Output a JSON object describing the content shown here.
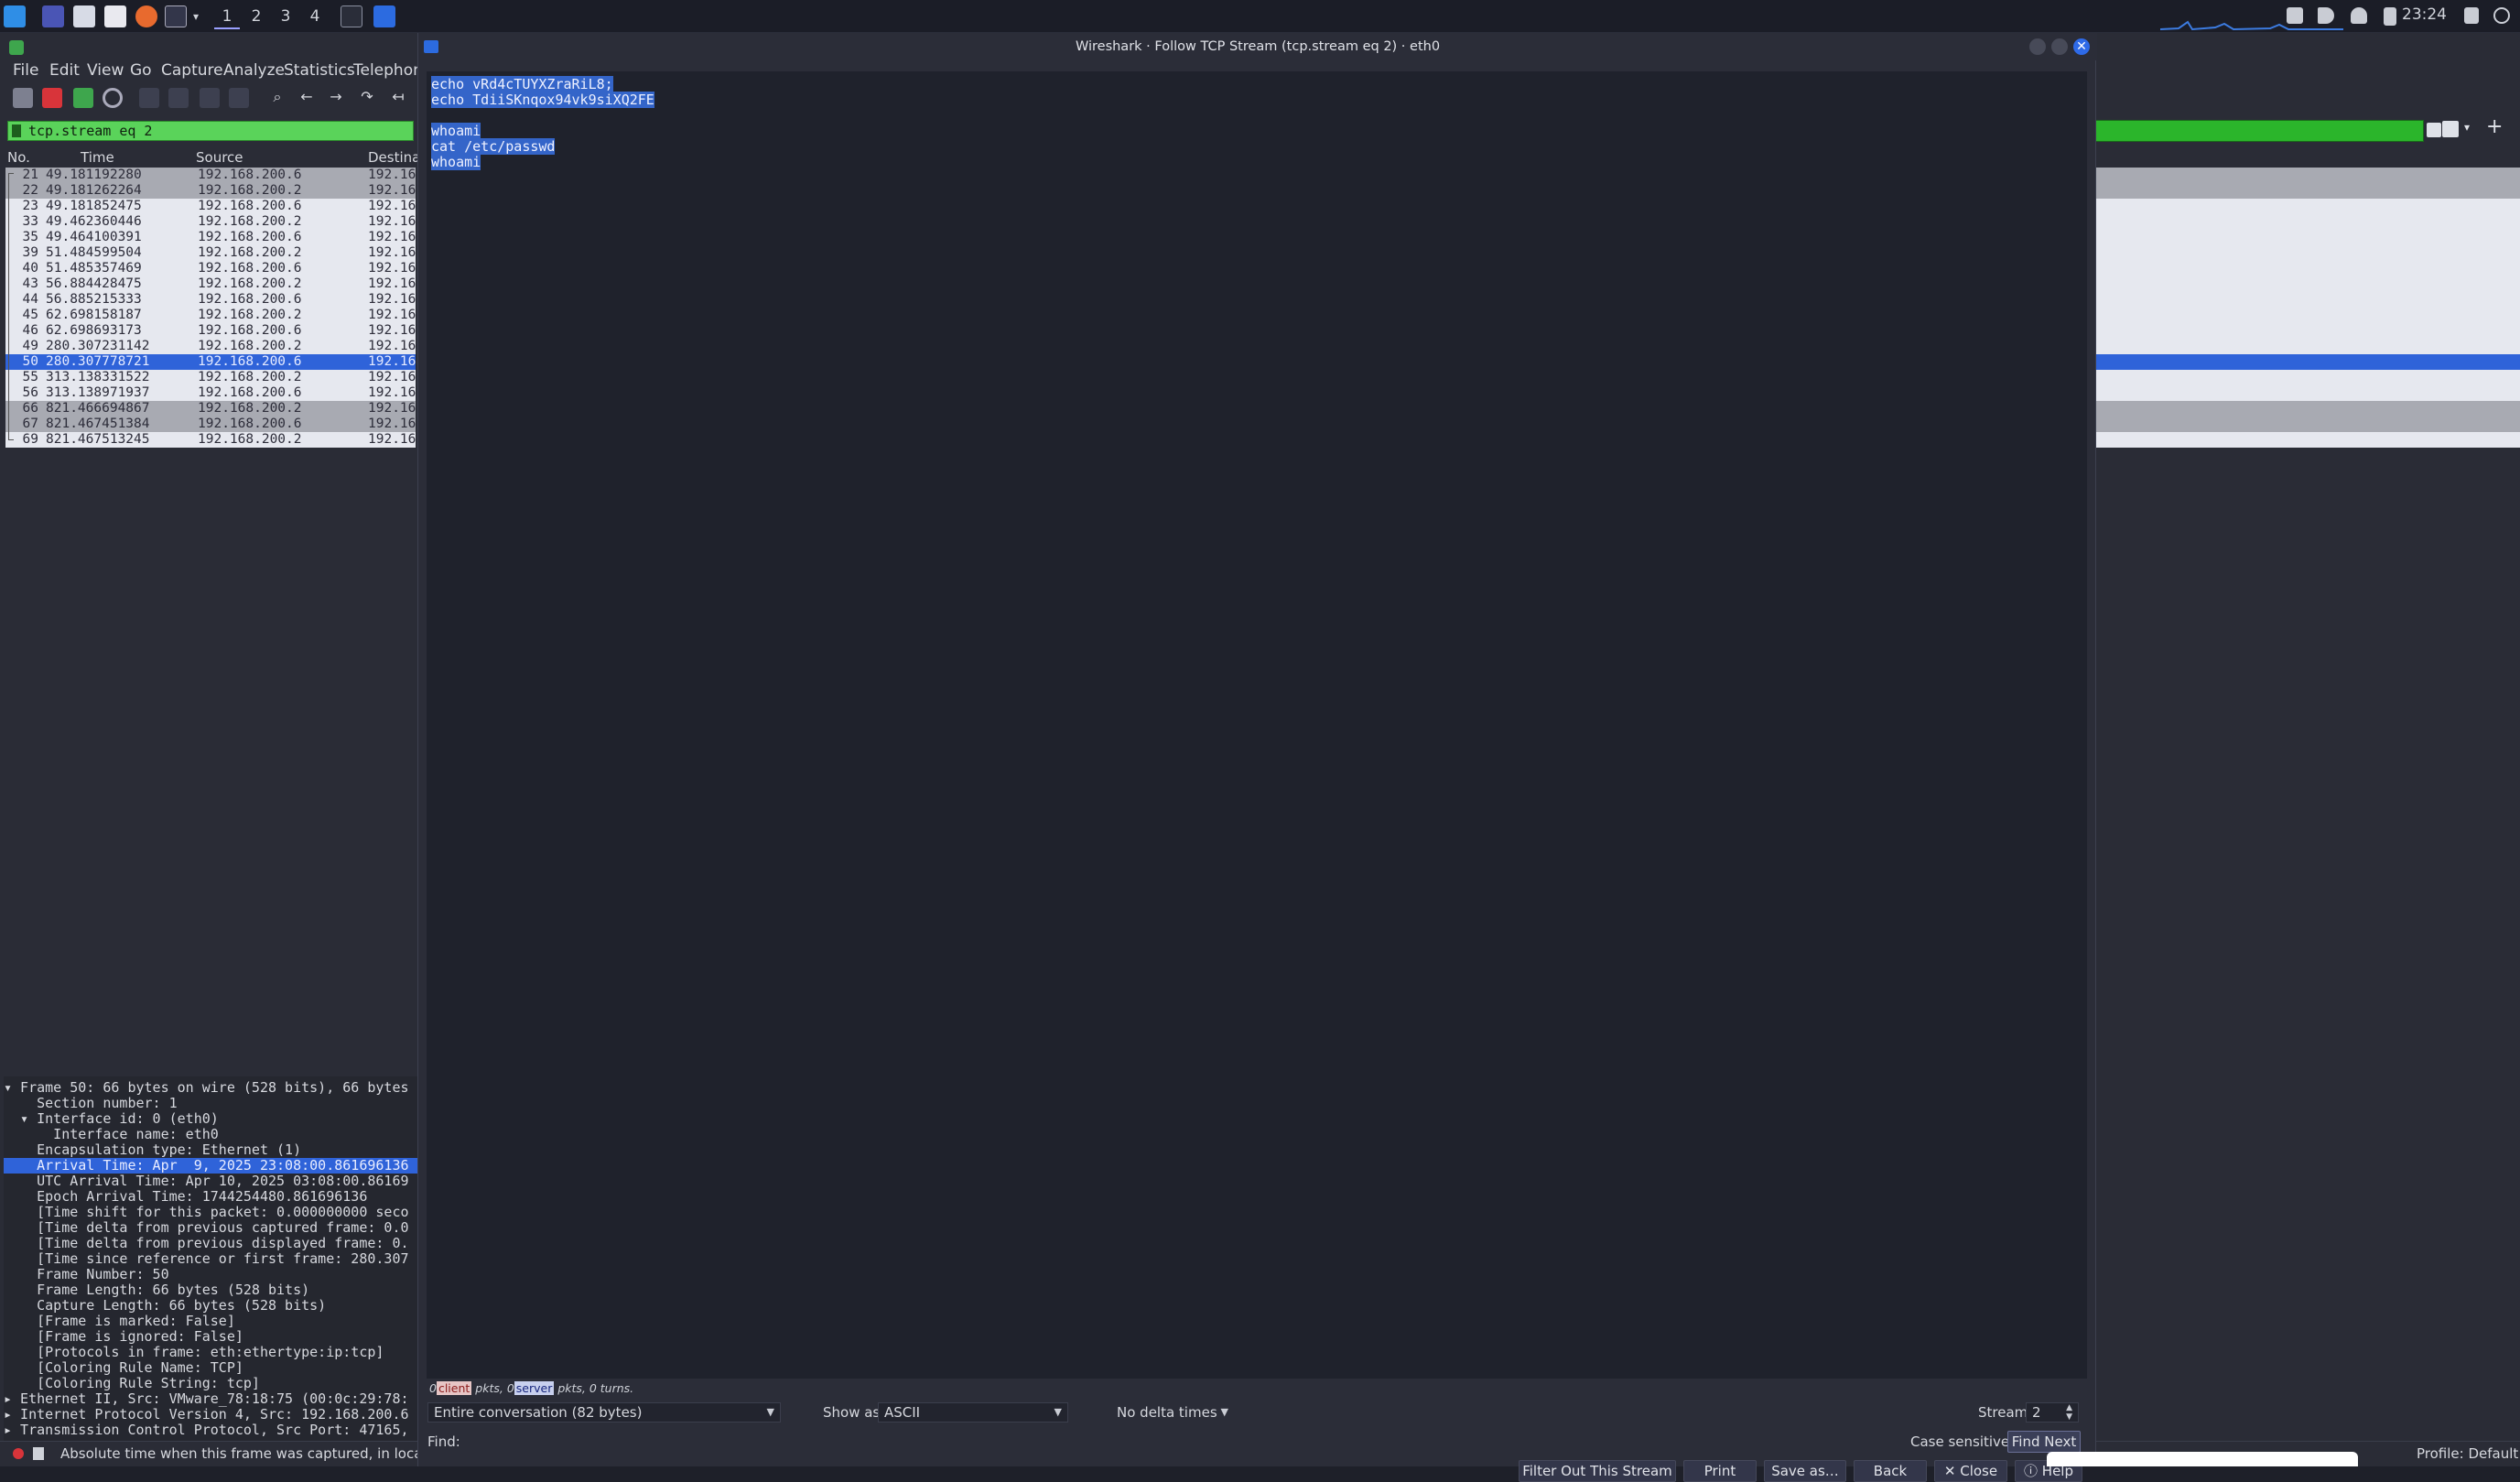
{
  "taskbar": {
    "workspaces": [
      "1",
      "2",
      "3",
      "4"
    ],
    "clock": "23:24"
  },
  "main": {
    "menu": [
      "File",
      "Edit",
      "View",
      "Go",
      "Capture",
      "Analyze",
      "Statistics",
      "Telephony"
    ],
    "filter": "tcp.stream eq 2",
    "columns": [
      "No.",
      "Time",
      "Source",
      "Destina"
    ],
    "packets": [
      {
        "no": "21",
        "time": "49.181192280",
        "src": "192.168.200.6",
        "dst": "192.16"
      },
      {
        "no": "22",
        "time": "49.181262264",
        "src": "192.168.200.2",
        "dst": "192.16"
      },
      {
        "no": "23",
        "time": "49.181852475",
        "src": "192.168.200.6",
        "dst": "192.16"
      },
      {
        "no": "33",
        "time": "49.462360446",
        "src": "192.168.200.2",
        "dst": "192.16"
      },
      {
        "no": "35",
        "time": "49.464100391",
        "src": "192.168.200.6",
        "dst": "192.16"
      },
      {
        "no": "39",
        "time": "51.484599504",
        "src": "192.168.200.2",
        "dst": "192.16"
      },
      {
        "no": "40",
        "time": "51.485357469",
        "src": "192.168.200.6",
        "dst": "192.16"
      },
      {
        "no": "43",
        "time": "56.884428475",
        "src": "192.168.200.2",
        "dst": "192.16"
      },
      {
        "no": "44",
        "time": "56.885215333",
        "src": "192.168.200.6",
        "dst": "192.16"
      },
      {
        "no": "45",
        "time": "62.698158187",
        "src": "192.168.200.2",
        "dst": "192.16"
      },
      {
        "no": "46",
        "time": "62.698693173",
        "src": "192.168.200.6",
        "dst": "192.16"
      },
      {
        "no": "49",
        "time": "280.307231142",
        "src": "192.168.200.2",
        "dst": "192.16"
      },
      {
        "no": "50",
        "time": "280.307778721",
        "src": "192.168.200.6",
        "dst": "192.16"
      },
      {
        "no": "55",
        "time": "313.138331522",
        "src": "192.168.200.2",
        "dst": "192.16"
      },
      {
        "no": "56",
        "time": "313.138971937",
        "src": "192.168.200.6",
        "dst": "192.16"
      },
      {
        "no": "66",
        "time": "821.466694867",
        "src": "192.168.200.2",
        "dst": "192.16"
      },
      {
        "no": "67",
        "time": "821.467451384",
        "src": "192.168.200.6",
        "dst": "192.16"
      },
      {
        "no": "69",
        "time": "821.467513245",
        "src": "192.168.200.2",
        "dst": "192.16"
      }
    ],
    "details": [
      "▾ Frame 50: 66 bytes on wire (528 bits), 66 bytes",
      "    Section number: 1",
      "  ▾ Interface id: 0 (eth0)",
      "      Interface name: eth0",
      "    Encapsulation type: Ethernet (1)",
      "    Arrival Time: Apr  9, 2025 23:08:00.861696136",
      "    UTC Arrival Time: Apr 10, 2025 03:08:00.86169",
      "    Epoch Arrival Time: 1744254480.861696136",
      "    [Time shift for this packet: 0.000000000 seco",
      "    [Time delta from previous captured frame: 0.0",
      "    [Time delta from previous displayed frame: 0.",
      "    [Time since reference or first frame: 280.307",
      "    Frame Number: 50",
      "    Frame Length: 66 bytes (528 bits)",
      "    Capture Length: 66 bytes (528 bits)",
      "    [Frame is marked: False]",
      "    [Frame is ignored: False]",
      "    [Protocols in frame: eth:ethertype:ip:tcp]",
      "    [Coloring Rule Name: TCP]",
      "    [Coloring Rule String: tcp]",
      "▸ Ethernet II, Src: VMware_78:18:75 (00:0c:29:78:",
      "▸ Internet Protocol Version 4, Src: 192.168.200.6",
      "▸ Transmission Control Protocol, Src Port: 47165,"
    ],
    "status_text": "Absolute time when this frame was captured, in local time",
    "profile": "Profile: Default"
  },
  "dialog": {
    "title": "Wireshark · Follow TCP Stream (tcp.stream eq 2) · eth0",
    "stream_lines": [
      "echo vRd4cTUYXZraRiL8;",
      "echo TdiiSKnqox94vk9siXQ2FE",
      "",
      "whoami",
      "cat /etc/passwd",
      "whoami"
    ],
    "pkt_info": {
      "client_count": "0",
      "client_label": "client",
      "pkts1": " pkts, ",
      "server_count": "0",
      "server_label": "server",
      "pkts2": " pkts, 0 turns."
    },
    "conversation": "Entire conversation (82 bytes)",
    "show_as_label": "Show as",
    "show_as_value": "ASCII",
    "delta": "No delta times",
    "stream_label": "Stream",
    "stream_value": "2",
    "find_label": "Find:",
    "case_sensitive": "Case sensitive",
    "find_next": "Find Next",
    "buttons": {
      "filter_out": "Filter Out This Stream",
      "print": "Print",
      "save_as": "Save as…",
      "back": "Back",
      "close": "✕ Close",
      "help": "Help"
    }
  }
}
